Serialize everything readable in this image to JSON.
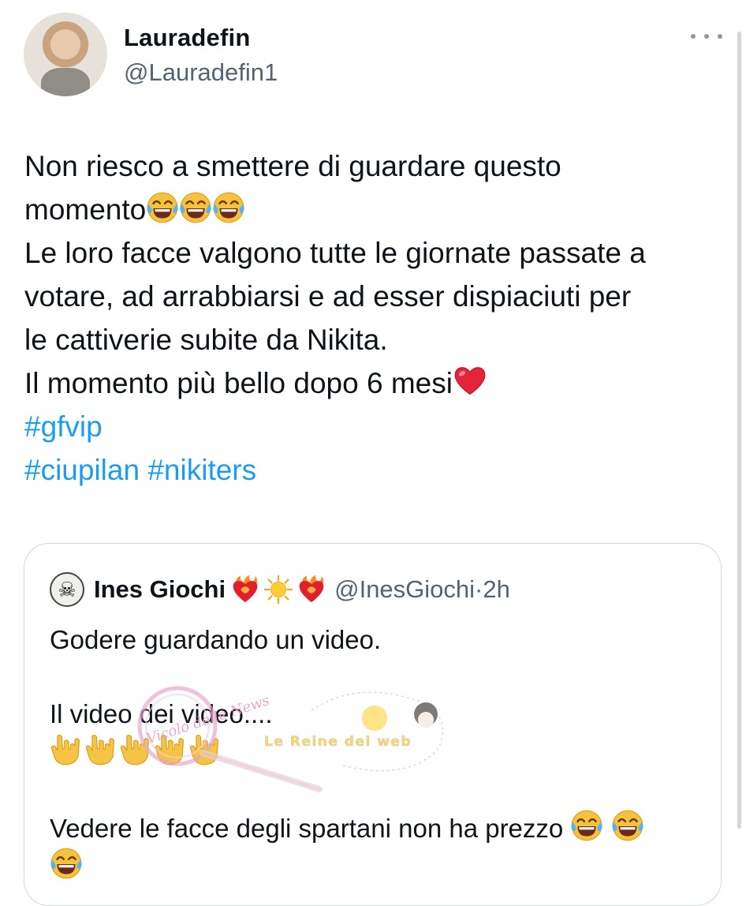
{
  "author": {
    "display_name": "Lauradefin",
    "handle": "@Lauradefin1"
  },
  "tweet": {
    "line1": "Non riesco a smettere di guardare questo",
    "line2": "momento",
    "line3": "Le loro facce valgono tutte le giornate passate a",
    "line4": "votare, ad arrabbiarsi e ad esser dispiaciuti per",
    "line5": "le cattiverie subite da Nikita.",
    "line6": "Il momento più bello dopo 6 mesi",
    "hashtag1": "#gfvip",
    "hashtag2": "#ciupilan",
    "hashtag3": "#nikiters"
  },
  "quoted": {
    "display_name": "Ines Giochi",
    "handle": "@InesGiochi",
    "separator": "·",
    "time": "2h",
    "line1": "Godere guardando un video.",
    "line2": "Il video dei video....",
    "line3": "Vedere le facce degli spartani non ha prezzo"
  },
  "watermark": {
    "text1": "Vicolo delle News",
    "text2": "Le Reine dei web"
  },
  "icons": {
    "more": "more-horizontal-icon",
    "laugh_emoji": "face-with-tears-of-joy-emoji",
    "heart_emoji": "red-heart-emoji",
    "fire_heart_emoji": "heart-on-fire-emoji",
    "sun_emoji": "sun-emoji",
    "rock_hand_emoji": "love-you-gesture-emoji",
    "skull_emoji": "skull-avatar"
  },
  "colors": {
    "text": "#0f1419",
    "secondary": "#536471",
    "hashtag": "#1d9bf0",
    "border": "#cfd9de"
  }
}
